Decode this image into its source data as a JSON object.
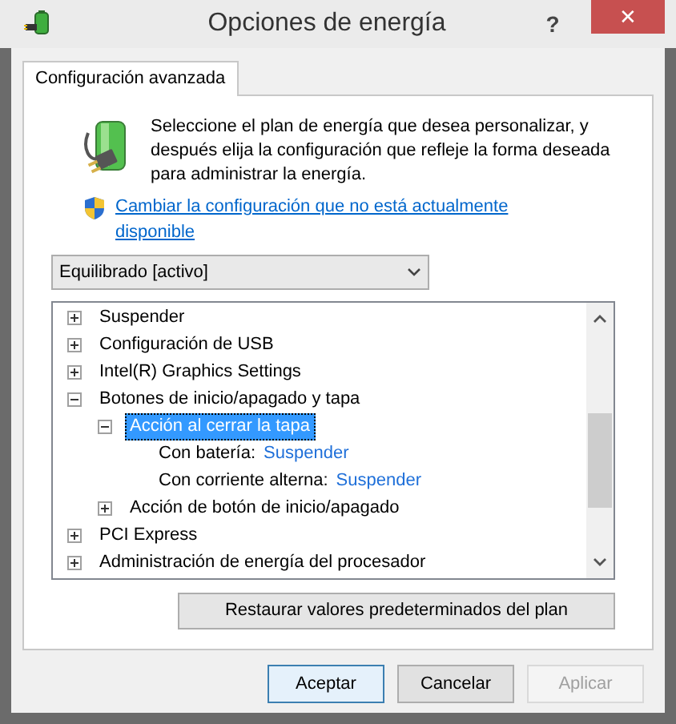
{
  "window": {
    "title": "Opciones de energía",
    "help": "?",
    "close": "✕"
  },
  "tabs": [
    {
      "label": "Configuración avanzada",
      "selected": true
    }
  ],
  "intro": "Seleccione el plan de energía que desea personalizar, y después elija la configuración que refleje la forma deseada para administrar la energía.",
  "admin_link": "Cambiar la configuración que no está actualmente disponible",
  "plan_select": {
    "value": "Equilibrado [activo]"
  },
  "tree": [
    {
      "kind": "group",
      "label": "Suspender",
      "expanded": false,
      "selected": false
    },
    {
      "kind": "group",
      "label": "Configuración de USB",
      "expanded": false,
      "selected": false
    },
    {
      "kind": "group",
      "label": "Intel(R) Graphics Settings",
      "expanded": false,
      "selected": false
    },
    {
      "kind": "group",
      "label": "Botones de inicio/apagado y tapa",
      "expanded": true,
      "selected": false,
      "children": [
        {
          "kind": "group",
          "label": "Acción al cerrar la tapa",
          "expanded": true,
          "selected": true,
          "children": [
            {
              "kind": "setting",
              "label": "Con batería:",
              "value": "Suspender"
            },
            {
              "kind": "setting",
              "label": "Con corriente alterna:",
              "value": "Suspender"
            }
          ]
        },
        {
          "kind": "group",
          "label": "Acción de botón de inicio/apagado",
          "expanded": false,
          "selected": false
        }
      ]
    },
    {
      "kind": "group",
      "label": "PCI Express",
      "expanded": false,
      "selected": false
    },
    {
      "kind": "group",
      "label": "Administración de energía del procesador",
      "expanded": false,
      "selected": false
    }
  ],
  "restore_button": "Restaurar valores predeterminados del plan",
  "buttons": [
    {
      "label": "Aceptar",
      "default": true,
      "disabled": false
    },
    {
      "label": "Cancelar",
      "default": false,
      "disabled": false
    },
    {
      "label": "Aplicar",
      "default": false,
      "disabled": true
    }
  ]
}
